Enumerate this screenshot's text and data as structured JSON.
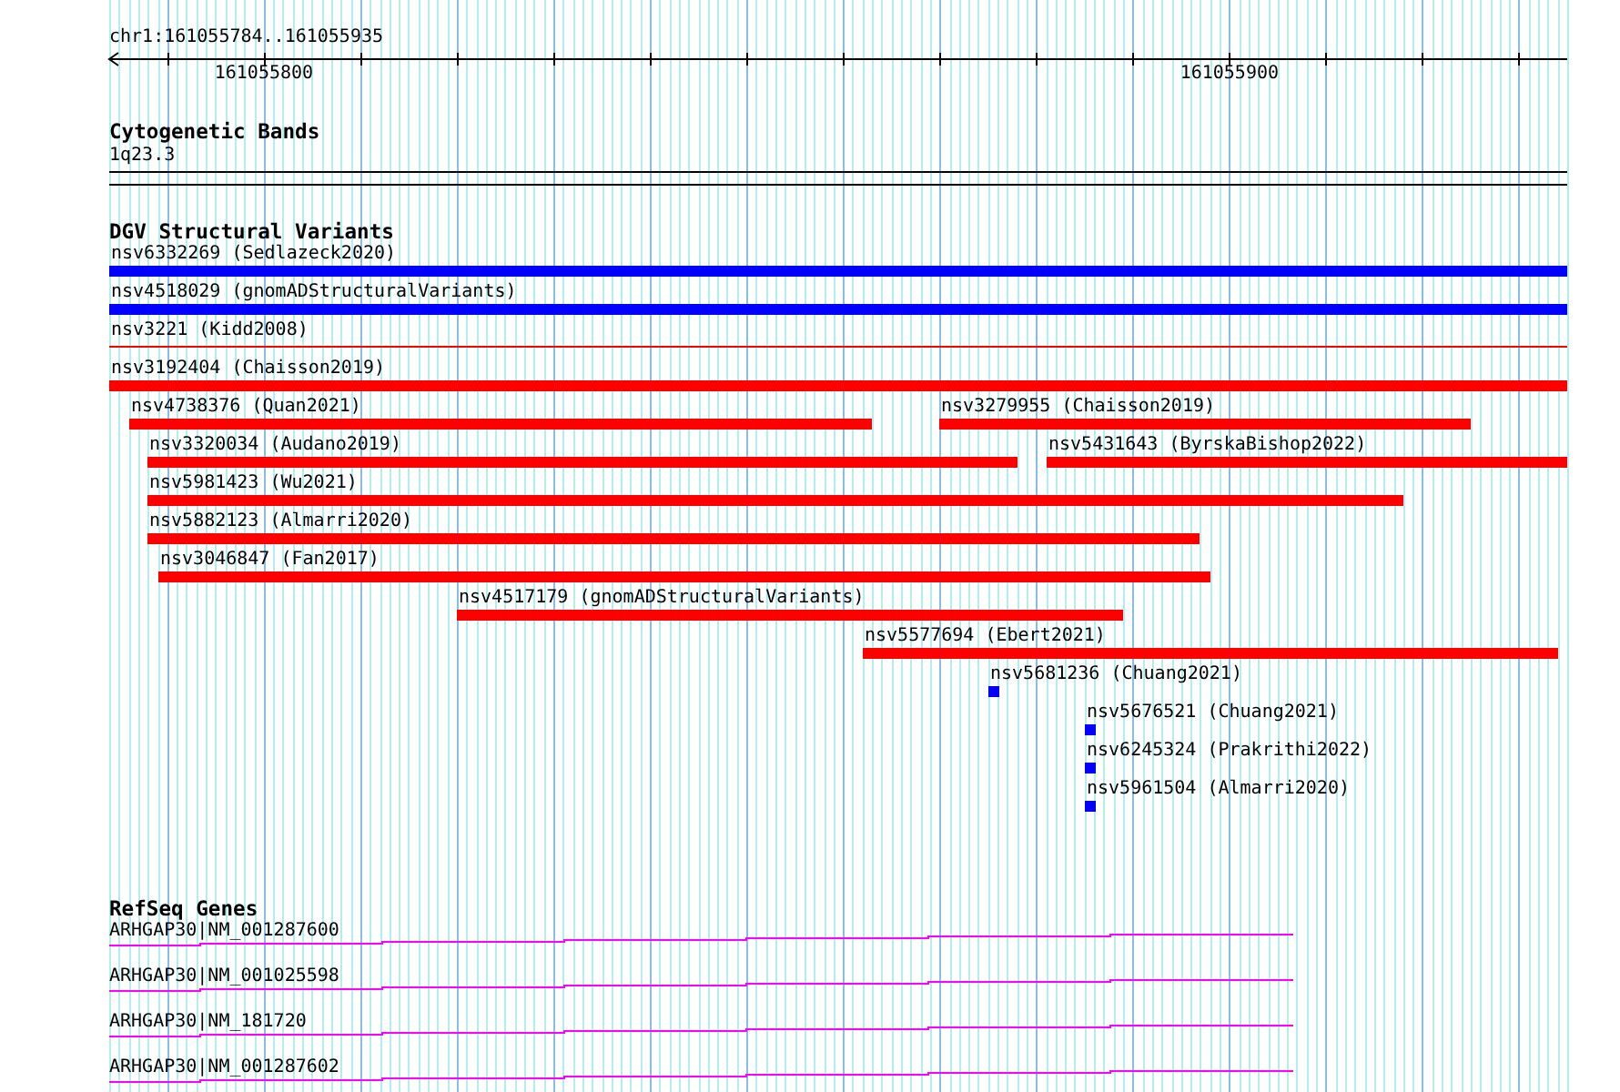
{
  "ruler": {
    "title": "chr1:161055784..161055935",
    "labels": [
      "161055800",
      "161055900"
    ]
  },
  "tracks": [
    {
      "kind": "bands",
      "title": "Cytogenetic Bands",
      "features": [
        {
          "label": "1q23.3"
        }
      ]
    },
    {
      "kind": "variants",
      "title": "DGV Structural Variants",
      "rows": [
        [
          {
            "kind": "bar",
            "label": "nsv6332269 (Sedlazeck2020)",
            "color": "#0000ff"
          }
        ],
        [
          {
            "kind": "bar",
            "label": "nsv4518029 (gnomADStructuralVariants)",
            "color": "#0000ff"
          }
        ],
        [
          {
            "kind": "line",
            "label": "nsv3221 (Kidd2008)",
            "color": "#ff0000"
          }
        ],
        [
          {
            "kind": "bar",
            "label": "nsv3192404 (Chaisson2019)",
            "color": "#ff0000"
          }
        ],
        [
          {
            "kind": "bar",
            "label": "nsv4738376 (Quan2021)",
            "color": "#ff0000"
          },
          {
            "kind": "bar",
            "label": "nsv3279955 (Chaisson2019)",
            "color": "#ff0000"
          }
        ],
        [
          {
            "kind": "bar",
            "label": "nsv3320034 (Audano2019)",
            "color": "#ff0000"
          },
          {
            "kind": "bar",
            "label": "nsv5431643 (ByrskaBishop2022)",
            "color": "#ff0000"
          }
        ],
        [
          {
            "kind": "bar",
            "label": "nsv5981423 (Wu2021)",
            "color": "#ff0000"
          }
        ],
        [
          {
            "kind": "bar",
            "label": "nsv5882123 (Almarri2020)",
            "color": "#ff0000"
          }
        ],
        [
          {
            "kind": "bar",
            "label": "nsv3046847 (Fan2017)",
            "color": "#ff0000"
          }
        ],
        [
          {
            "kind": "bar",
            "label": "nsv4517179 (gnomADStructuralVariants)",
            "color": "#ff0000"
          }
        ],
        [
          {
            "kind": "bar",
            "label": "nsv5577694 (Ebert2021)",
            "color": "#ff0000"
          }
        ],
        [
          {
            "kind": "bar",
            "label": "nsv5681236 (Chuang2021)",
            "color": "#0000ff"
          }
        ],
        [
          {
            "kind": "bar",
            "label": "nsv5676521 (Chuang2021)",
            "color": "#0000ff"
          }
        ],
        [
          {
            "kind": "bar",
            "label": "nsv6245324 (Prakrithi2022)",
            "color": "#0000ff"
          }
        ],
        [
          {
            "kind": "bar",
            "label": "nsv5961504 (Almarri2020)",
            "color": "#0000ff"
          }
        ]
      ]
    },
    {
      "kind": "genes",
      "title": "RefSeq Genes",
      "features": [
        {
          "label": "ARHGAP30|NM_001287600"
        },
        {
          "label": "ARHGAP30|NM_001025598"
        },
        {
          "label": "ARHGAP30|NM_181720"
        },
        {
          "label": "ARHGAP30|NM_001287602"
        }
      ]
    }
  ]
}
